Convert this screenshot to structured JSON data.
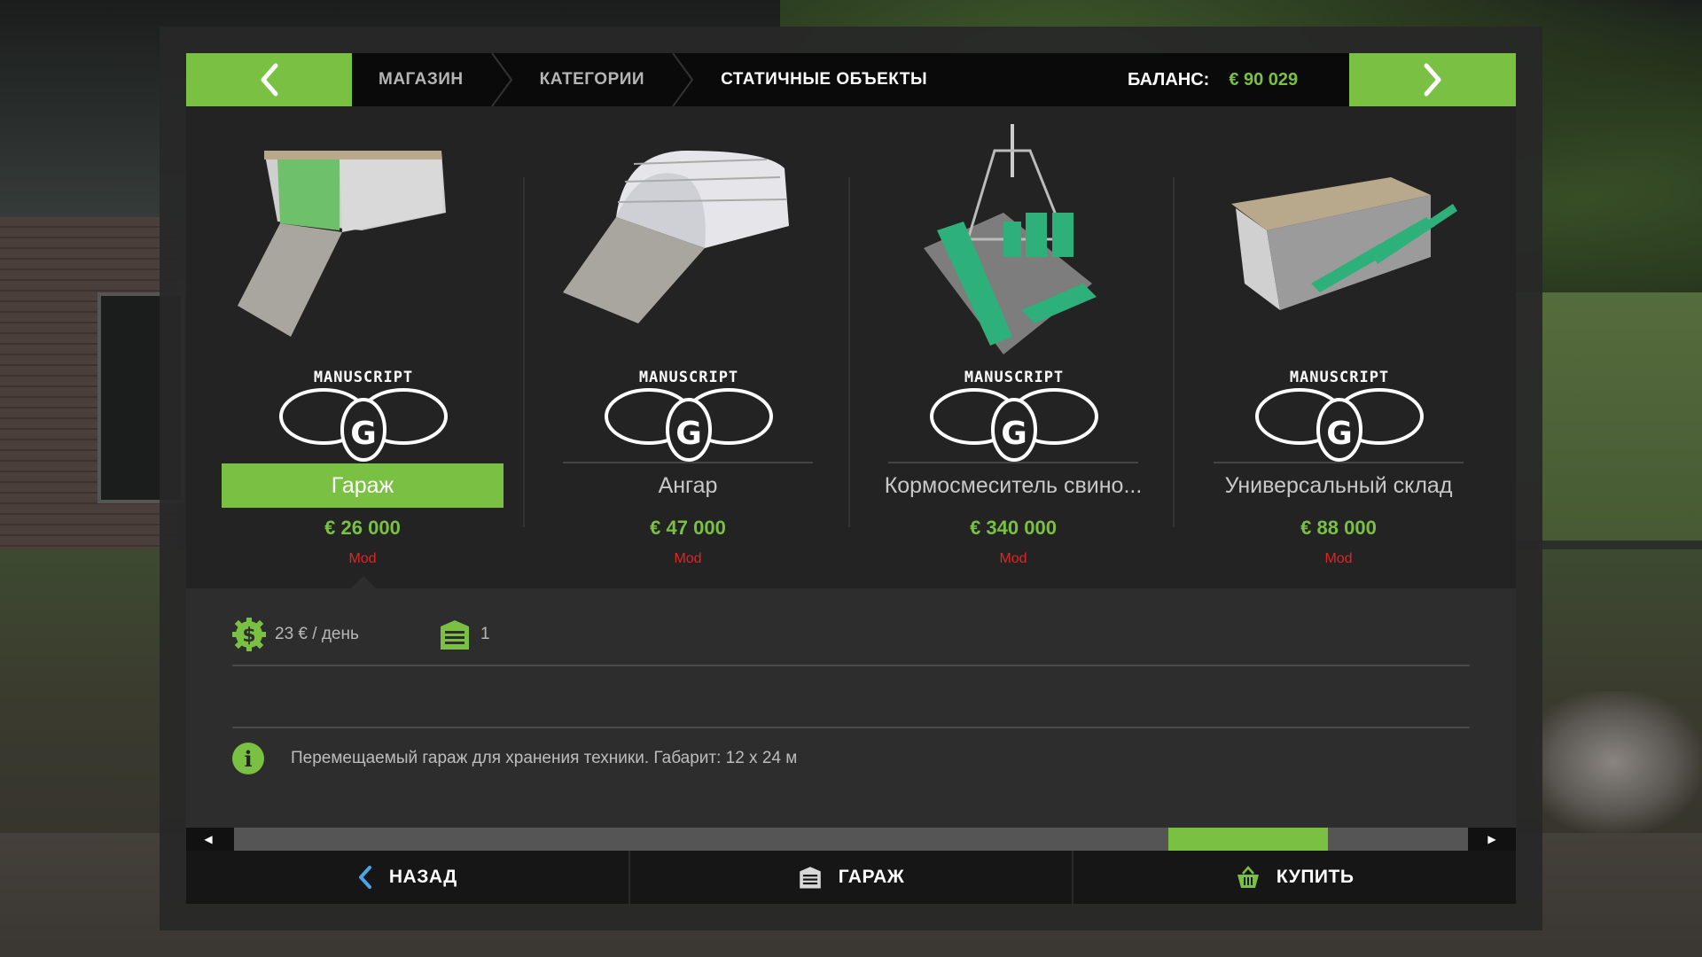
{
  "breadcrumbs": [
    "МАГАЗИН",
    "КАТЕГОРИИ",
    "СТАТИЧНЫЕ ОБЪЕКТЫ"
  ],
  "balance": {
    "label": "БАЛАНС:",
    "value": "€ 90 029"
  },
  "brand_logo_text": "MANUSCRIPT",
  "items": [
    {
      "name": "Гараж",
      "price": "€ 26 000",
      "tag": "Mod",
      "selected": true
    },
    {
      "name": "Ангар",
      "price": "€ 47 000",
      "tag": "Mod",
      "selected": false
    },
    {
      "name": "Кормосмеситель свино...",
      "price": "€ 340 000",
      "tag": "Mod",
      "selected": false
    },
    {
      "name": "Универсальный склад",
      "price": "€ 88 000",
      "tag": "Mod",
      "selected": false
    }
  ],
  "details": {
    "upkeep": "23 € / день",
    "capacity": "1",
    "description": "Перемещаемый гараж для хранения техники. Габарит: 12 x 24 м",
    "info_glyph": "i"
  },
  "scroll": {
    "position": 0.87
  },
  "buttons": {
    "back": "НАЗАД",
    "garage": "ГАРАЖ",
    "buy": "КУПИТЬ"
  },
  "colors": {
    "accent": "#7ac143",
    "mod": "#e02525",
    "panel": "#232323",
    "topbar": "#0a0a0a"
  },
  "icons": [
    "chevron-left-icon",
    "chevron-right-icon",
    "dollar-gear-icon",
    "garage-icon",
    "info-icon",
    "basket-icon",
    "scroll-left-icon",
    "scroll-right-icon"
  ]
}
